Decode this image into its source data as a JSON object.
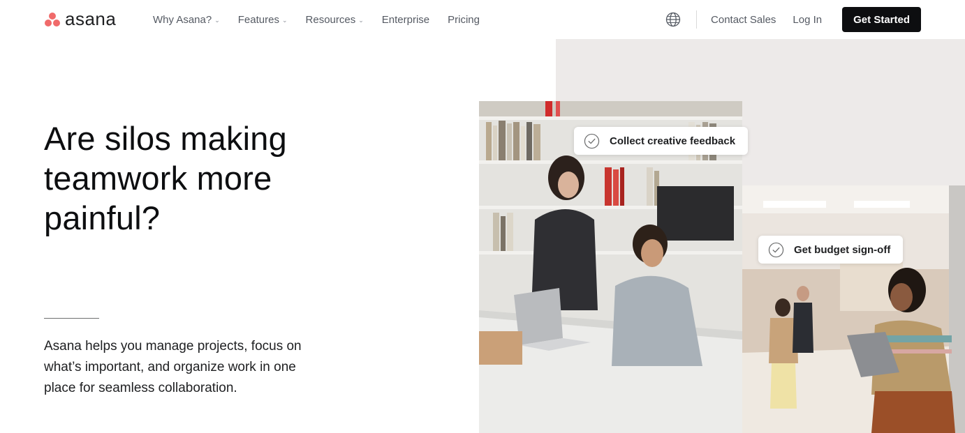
{
  "brand": {
    "name": "asana",
    "accent": "#f06a6a"
  },
  "nav": {
    "items": [
      {
        "label": "Why Asana?",
        "dropdown": true
      },
      {
        "label": "Features",
        "dropdown": true
      },
      {
        "label": "Resources",
        "dropdown": true
      },
      {
        "label": "Enterprise",
        "dropdown": false
      },
      {
        "label": "Pricing",
        "dropdown": false
      }
    ],
    "icons": {
      "globe": "globe-icon",
      "chevron": "chevron-down-icon"
    }
  },
  "header_right": {
    "contact_sales": "Contact Sales",
    "log_in": "Log In",
    "get_started": "Get Started"
  },
  "hero": {
    "title": "Are silos making teamwork more painful?",
    "description": "Asana helps you manage projects, focus on what’s important, and organize work in one place for seamless collaboration."
  },
  "task_cards": [
    {
      "label": "Collect creative feedback",
      "icon": "check-circle-icon"
    },
    {
      "label": "Get budget sign-off",
      "icon": "check-circle-icon"
    }
  ]
}
